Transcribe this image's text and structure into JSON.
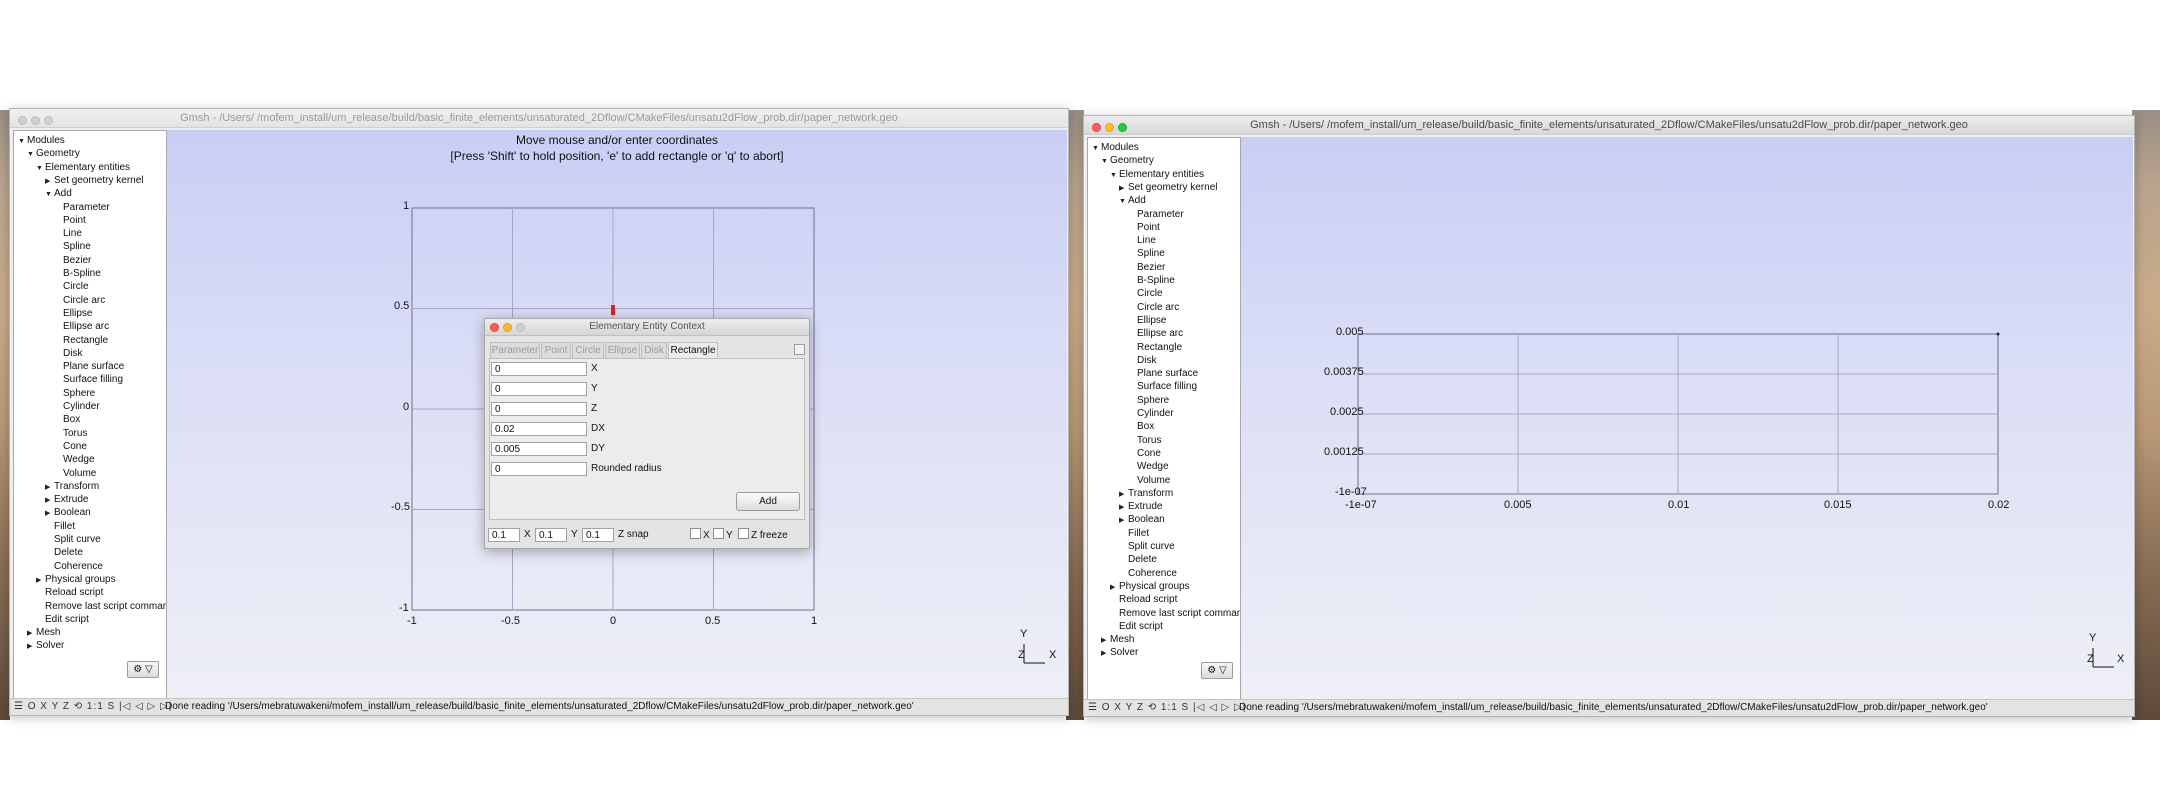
{
  "left_window": {
    "title": "Gmsh - /Users/                    /mofem_install/um_release/build/basic_finite_elements/unsaturated_2Dflow/CMakeFiles/unsatu2dFlow_prob.dir/paper_network.geo",
    "tree": [
      {
        "label": "Modules",
        "arrow": "▼",
        "level": 0
      },
      {
        "label": "Geometry",
        "arrow": "▼",
        "level": 1
      },
      {
        "label": "Elementary entities",
        "arrow": "▼",
        "level": 2
      },
      {
        "label": "Set geometry kernel",
        "arrow": "▶",
        "level": 3
      },
      {
        "label": "Add",
        "arrow": "▼",
        "level": 3
      },
      {
        "label": "Parameter",
        "arrow": "",
        "level": 4
      },
      {
        "label": "Point",
        "arrow": "",
        "level": 4
      },
      {
        "label": "Line",
        "arrow": "",
        "level": 4
      },
      {
        "label": "Spline",
        "arrow": "",
        "level": 4
      },
      {
        "label": "Bezier",
        "arrow": "",
        "level": 4
      },
      {
        "label": "B-Spline",
        "arrow": "",
        "level": 4
      },
      {
        "label": "Circle",
        "arrow": "",
        "level": 4
      },
      {
        "label": "Circle arc",
        "arrow": "",
        "level": 4
      },
      {
        "label": "Ellipse",
        "arrow": "",
        "level": 4
      },
      {
        "label": "Ellipse arc",
        "arrow": "",
        "level": 4
      },
      {
        "label": "Rectangle",
        "arrow": "",
        "level": 4
      },
      {
        "label": "Disk",
        "arrow": "",
        "level": 4
      },
      {
        "label": "Plane surface",
        "arrow": "",
        "level": 4
      },
      {
        "label": "Surface filling",
        "arrow": "",
        "level": 4
      },
      {
        "label": "Sphere",
        "arrow": "",
        "level": 4
      },
      {
        "label": "Cylinder",
        "arrow": "",
        "level": 4
      },
      {
        "label": "Box",
        "arrow": "",
        "level": 4
      },
      {
        "label": "Torus",
        "arrow": "",
        "level": 4
      },
      {
        "label": "Cone",
        "arrow": "",
        "level": 4
      },
      {
        "label": "Wedge",
        "arrow": "",
        "level": 4
      },
      {
        "label": "Volume",
        "arrow": "",
        "level": 4
      },
      {
        "label": "Transform",
        "arrow": "▶",
        "level": 3
      },
      {
        "label": "Extrude",
        "arrow": "▶",
        "level": 3
      },
      {
        "label": "Boolean",
        "arrow": "▶",
        "level": 3
      },
      {
        "label": "Fillet",
        "arrow": "",
        "level": 3
      },
      {
        "label": "Split curve",
        "arrow": "",
        "level": 3
      },
      {
        "label": "Delete",
        "arrow": "",
        "level": 3
      },
      {
        "label": "Coherence",
        "arrow": "",
        "level": 3
      },
      {
        "label": "Physical groups",
        "arrow": "▶",
        "level": 2
      },
      {
        "label": "Reload script",
        "arrow": "",
        "level": 2
      },
      {
        "label": "Remove last script command",
        "arrow": "",
        "level": 2
      },
      {
        "label": "Edit script",
        "arrow": "",
        "level": 2
      },
      {
        "label": "Mesh",
        "arrow": "▶",
        "level": 1
      },
      {
        "label": "Solver",
        "arrow": "▶",
        "level": 1
      }
    ],
    "gear_label": "⚙ ▽",
    "hint_line1": "Move mouse and/or enter coordinates",
    "hint_line2": "[Press 'Shift' to hold position, 'e' to add rectangle or 'q' to abort]",
    "x_ticks": [
      "-1",
      "-0.5",
      "0",
      "0.5",
      "1"
    ],
    "y_ticks": [
      "1",
      "0.5",
      "0",
      "-0.5",
      "-1"
    ],
    "axes_y": "Y",
    "axes_z": "Z",
    "axes_x": "X",
    "status_buttons": "☰ O X Y Z ⟲ 1:1 S  |◁ ◁ ▷ ▷|",
    "status_msg": "Done reading '/Users/mebratuwakeni/mofem_install/um_release/build/basic_finite_elements/unsaturated_2Dflow/CMakeFiles/unsatu2dFlow_prob.dir/paper_network.geo'"
  },
  "dialog": {
    "title": "Elementary Entity Context",
    "tabs": [
      "Parameter",
      "Point",
      "Circle",
      "Ellipse",
      "Disk",
      "Rectangle"
    ],
    "selected_tab": "Rectangle",
    "fields": [
      {
        "value": "0",
        "label": "X"
      },
      {
        "value": "0",
        "label": "Y"
      },
      {
        "value": "0",
        "label": "Z"
      },
      {
        "value": "0.02",
        "label": "DX"
      },
      {
        "value": "0.005",
        "label": "DY"
      },
      {
        "value": "0",
        "label": "Rounded radius"
      }
    ],
    "add_label": "Add",
    "snap_x": "0.1",
    "snap_x_label": "X",
    "snap_y": "0.1",
    "snap_y_label": "Y",
    "snap_z": "0.1",
    "snap_z_label": "Z snap",
    "chk_x": "X",
    "chk_y": "Y",
    "chk_zfreeze": "Z freeze"
  },
  "right_window": {
    "title": "Gmsh - /Users/                    /mofem_install/um_release/build/basic_finite_elements/unsaturated_2Dflow/CMakeFiles/unsatu2dFlow_prob.dir/paper_network.geo",
    "x_ticks": [
      "-1e-07",
      "0.005",
      "0.01",
      "0.015",
      "0.02"
    ],
    "y_ticks": [
      "0.005",
      "0.00375",
      "0.0025",
      "0.00125",
      "-1e-07"
    ],
    "axes_y": "Y",
    "axes_z": "Z",
    "axes_x": "X",
    "gear_label": "⚙ ▽",
    "status_buttons": "☰ O X Y Z ⟲ 1:1 S  |◁ ◁ ▷ ▷|",
    "status_msg": "Done reading '/Users/mebratuwakeni/mofem_install/um_release/build/basic_finite_elements/unsaturated_2Dflow/CMakeFiles/unsatu2dFlow_prob.dir/paper_network.geo'"
  },
  "colors": {
    "viewport_top": "#c9cef5",
    "viewport_bottom": "#eeeff7",
    "cursor_marker": "#e02020"
  }
}
